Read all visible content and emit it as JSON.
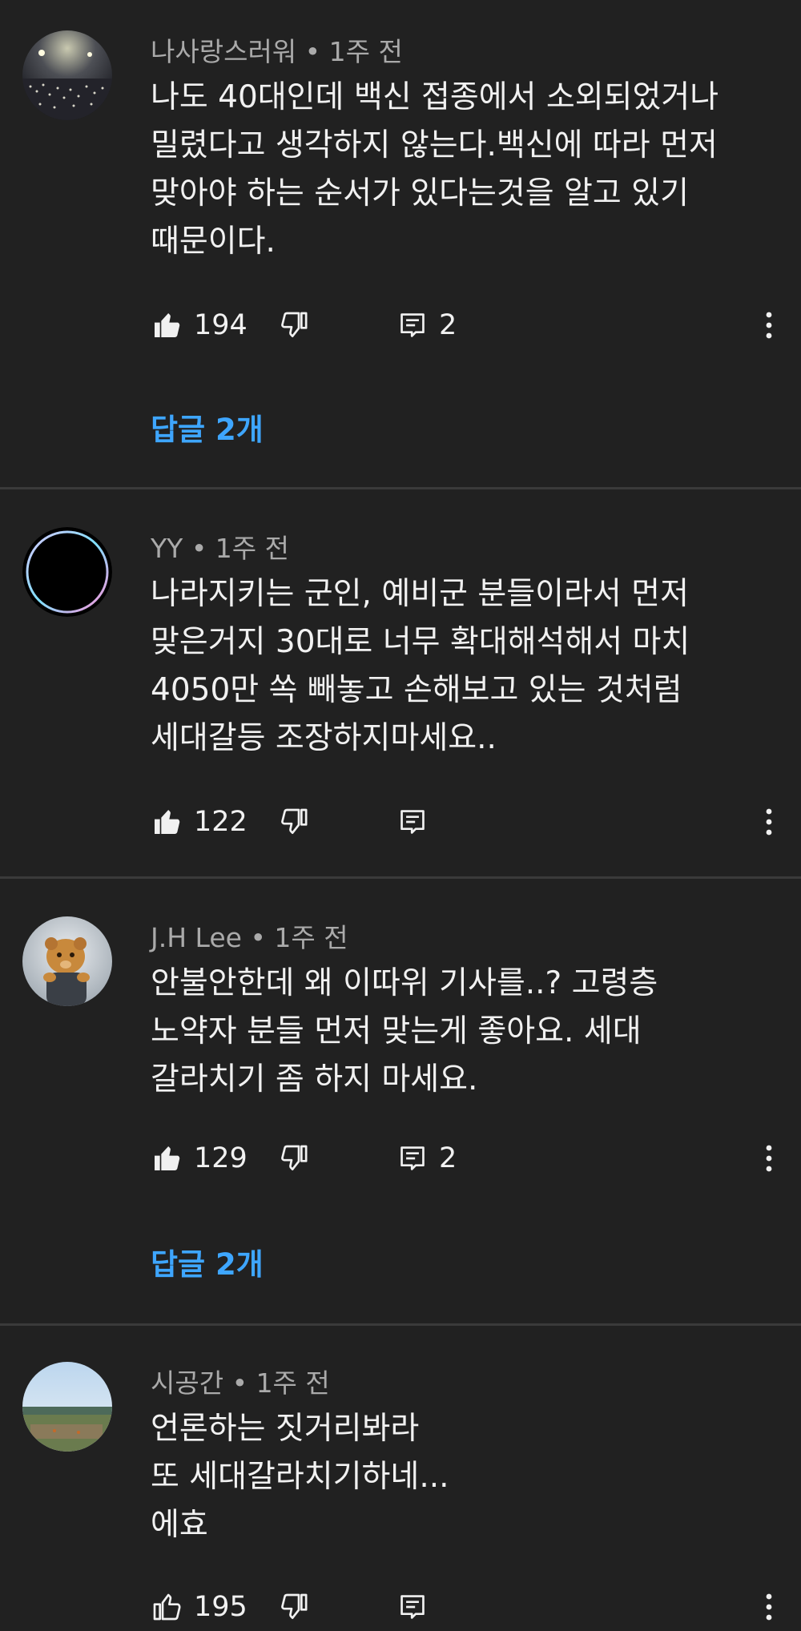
{
  "comments": [
    {
      "author": "나사랑스러워",
      "time": "1주 전",
      "lines": [
        "나도 40대인데 백신 접종에서 소외되었거나",
        "밀렸다고 생각하지 않는다.백신에 따라 먼저",
        "맞아야 하는 순서가 있다는것을 알고 있기",
        "때문이다."
      ],
      "likes": "194",
      "reply_count": "2",
      "replies_label": "답글 2개",
      "avatar_icon": "crowd-night-photo"
    },
    {
      "author": "YY",
      "time": "1주 전",
      "lines": [
        "나라지키는 군인, 예비군 분들이라서 먼저",
        "맞은거지 30대로 너무 확대해석해서 마치",
        "4050만 쏙 빼놓고 손해보고 있는 것처럼",
        "세대갈등 조장하지마세요.."
      ],
      "likes": "122",
      "avatar_icon": "black-circle-ring"
    },
    {
      "author": "J.H Lee",
      "time": "1주 전",
      "lines": [
        "안불안한데 왜 이따위 기사를..? 고령층",
        "노약자 분들 먼저 맞는게 좋아요. 세대",
        "갈라치기 좀 하지 마세요."
      ],
      "likes": "129",
      "reply_count": "2",
      "replies_label": "답글 2개",
      "avatar_icon": "lion-cub-photo"
    },
    {
      "author": "시공간",
      "time": "1주 전",
      "lines": [
        "언론하는 짓거리봐라",
        "또 세대갈라치기하네...",
        "에효"
      ],
      "likes": "195",
      "avatar_icon": "field-landscape-photo"
    }
  ],
  "icons": {
    "like": "thumbs-up-icon",
    "dislike": "thumbs-down-icon",
    "reply": "reply-comment-icon",
    "more": "more-vert-icon"
  },
  "colors": {
    "background": "#212121",
    "text": "#f1f1f1",
    "meta": "#aaaaaa",
    "link": "#3ea6ff",
    "divider": "#3a3a3a"
  }
}
